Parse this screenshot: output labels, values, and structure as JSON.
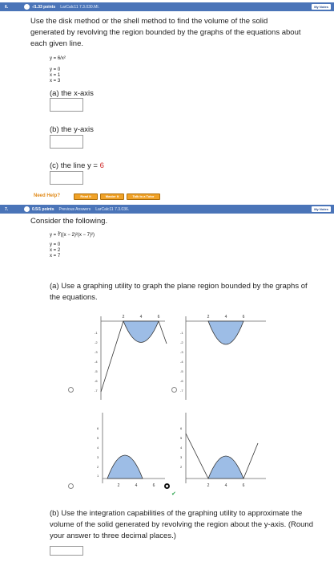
{
  "q6": {
    "number": "6.",
    "points": "-/1.33 points",
    "source": "LarCalc11 7.3.030.MI.",
    "notes": "My Notes",
    "prompt": "Use the disk method or the shell method to find the volume of the solid generated by revolving the region bounded by the graphs of the equations about each given line.",
    "eq1": "y = 6/x²",
    "eq2": "y = 0",
    "eq3": "x = 1",
    "eq4": "x = 3",
    "part_a": "(a) the x-axis",
    "part_b": "(b) the y-axis",
    "part_c_prefix": "(c) the line y = ",
    "part_c_value": "6",
    "need_help": "Need Help?",
    "help_buttons": [
      "Read It",
      "Master It",
      "Talk to a Tutor"
    ]
  },
  "q7": {
    "number": "7.",
    "points": "0.5/1 points",
    "previous": "Previous Answers",
    "source": "LarCalc11 7.3.036.",
    "notes": "My Notes",
    "prompt": "Consider the following.",
    "eq1": "y = ∛((x − 2)²(x − 7)²)",
    "eq2": "y = 0",
    "eq3": "x = 2",
    "eq4": "x = 7",
    "part_a": "(a) Use a graphing utility to graph the plane region bounded by the graphs of the equations.",
    "part_b": "(b) Use the integration capabilities of the graphing utility to approximate the volume of the solid generated by revolving the region about the y-axis. (Round your answer to three decimal places.)",
    "options": [
      {
        "selected": false,
        "correct": false
      },
      {
        "selected": false,
        "correct": false
      },
      {
        "selected": false,
        "correct": true
      },
      {
        "selected": true,
        "correct": false
      }
    ],
    "graph_top_ticks": [
      "2",
      "4",
      "6"
    ],
    "graph_y_ticks_neg": [
      "-1",
      "-2",
      "-3",
      "-4",
      "-5",
      "-6",
      "-7"
    ],
    "graph_y_ticks_pos": [
      "1",
      "2",
      "3",
      "4",
      "5",
      "6"
    ],
    "graph_x_ticks": [
      "2",
      "4",
      "6"
    ]
  },
  "colors": {
    "header_bar": "#4a74b8",
    "accent_red": "#cc2222",
    "help_orange": "#e08a1a",
    "fill_blue": "#9dbde6",
    "check_green": "#2da44e"
  }
}
